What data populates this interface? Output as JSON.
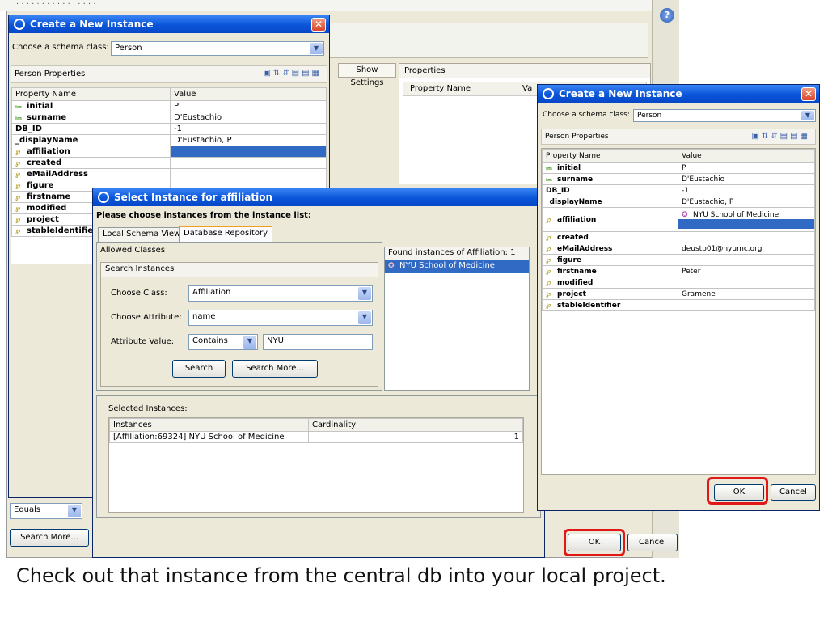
{
  "caption": "Check out that instance from the central db into your local project.",
  "background": {
    "show_settings": "Show Settings",
    "properties_title": "Properties",
    "property_name_header": "Property Name",
    "value_header_partial": "Va",
    "equals_option": "Equals",
    "search_more": "Search More...",
    "ok": "OK",
    "cancel": "Cancel"
  },
  "left_dialog": {
    "title": "Create a New Instance",
    "schema_label": "Choose a schema class:",
    "schema_value": "Person",
    "section_title": "Person Properties",
    "col_name": "Property Name",
    "col_value": "Value",
    "rows": [
      {
        "name": "initial",
        "value": "P"
      },
      {
        "name": "surname",
        "value": "D'Eustachio"
      },
      {
        "name": "DB_ID",
        "value": "-1"
      },
      {
        "name": "_displayName",
        "value": "D'Eustachio, P"
      },
      {
        "name": "affiliation",
        "value": ""
      },
      {
        "name": "created",
        "value": ""
      },
      {
        "name": "eMailAddress",
        "value": ""
      },
      {
        "name": "figure",
        "value": ""
      },
      {
        "name": "firstname",
        "value": ""
      },
      {
        "name": "modified",
        "value": ""
      },
      {
        "name": "project",
        "value": ""
      },
      {
        "name": "stableIdentifier",
        "value": ""
      }
    ]
  },
  "select_dialog": {
    "title": "Select Instance for affiliation",
    "instruction": "Please choose instances from the instance list:",
    "tabs": [
      "Local Schema View",
      "Database Repository"
    ],
    "allowed_classes": "Allowed Classes",
    "search_instances": "Search Instances",
    "choose_class_label": "Choose Class:",
    "choose_class_value": "Affiliation",
    "choose_attribute_label": "Choose Attribute:",
    "choose_attribute_value": "name",
    "attribute_value_label": "Attribute Value:",
    "match_mode": "Contains",
    "search_text": "NYU",
    "search_button": "Search",
    "search_more_button": "Search More...",
    "found_header": "Found instances of Affiliation: 1",
    "found_items": [
      "NYU School of Medicine"
    ],
    "selected_label": "Selected Instances:",
    "selected_col_instances": "Instances",
    "selected_col_cardinality": "Cardinality",
    "selected_rows": [
      {
        "instance": "[Affiliation:69324] NYU School of Medicine",
        "cardinality": "1"
      }
    ]
  },
  "right_dialog": {
    "title": "Create a New Instance",
    "schema_label": "Choose a schema class:",
    "schema_value": "Person",
    "section_title": "Person Properties",
    "col_name": "Property Name",
    "col_value": "Value",
    "rows": [
      {
        "name": "initial",
        "value": "P"
      },
      {
        "name": "surname",
        "value": "D'Eustachio"
      },
      {
        "name": "DB_ID",
        "value": "-1"
      },
      {
        "name": "_displayName",
        "value": "D'Eustachio, P"
      },
      {
        "name": "affiliation",
        "value": "NYU School of Medicine"
      },
      {
        "name": "created",
        "value": ""
      },
      {
        "name": "eMailAddress",
        "value": "deustp01@nyumc.org"
      },
      {
        "name": "figure",
        "value": ""
      },
      {
        "name": "firstname",
        "value": "Peter"
      },
      {
        "name": "modified",
        "value": ""
      },
      {
        "name": "project",
        "value": "Gramene"
      },
      {
        "name": "stableIdentifier",
        "value": ""
      }
    ],
    "ok": "OK",
    "cancel": "Cancel"
  },
  "colors": {
    "titlebar": "#0a55d8",
    "selection": "#316ac5",
    "highlight_red": "#e01818"
  }
}
